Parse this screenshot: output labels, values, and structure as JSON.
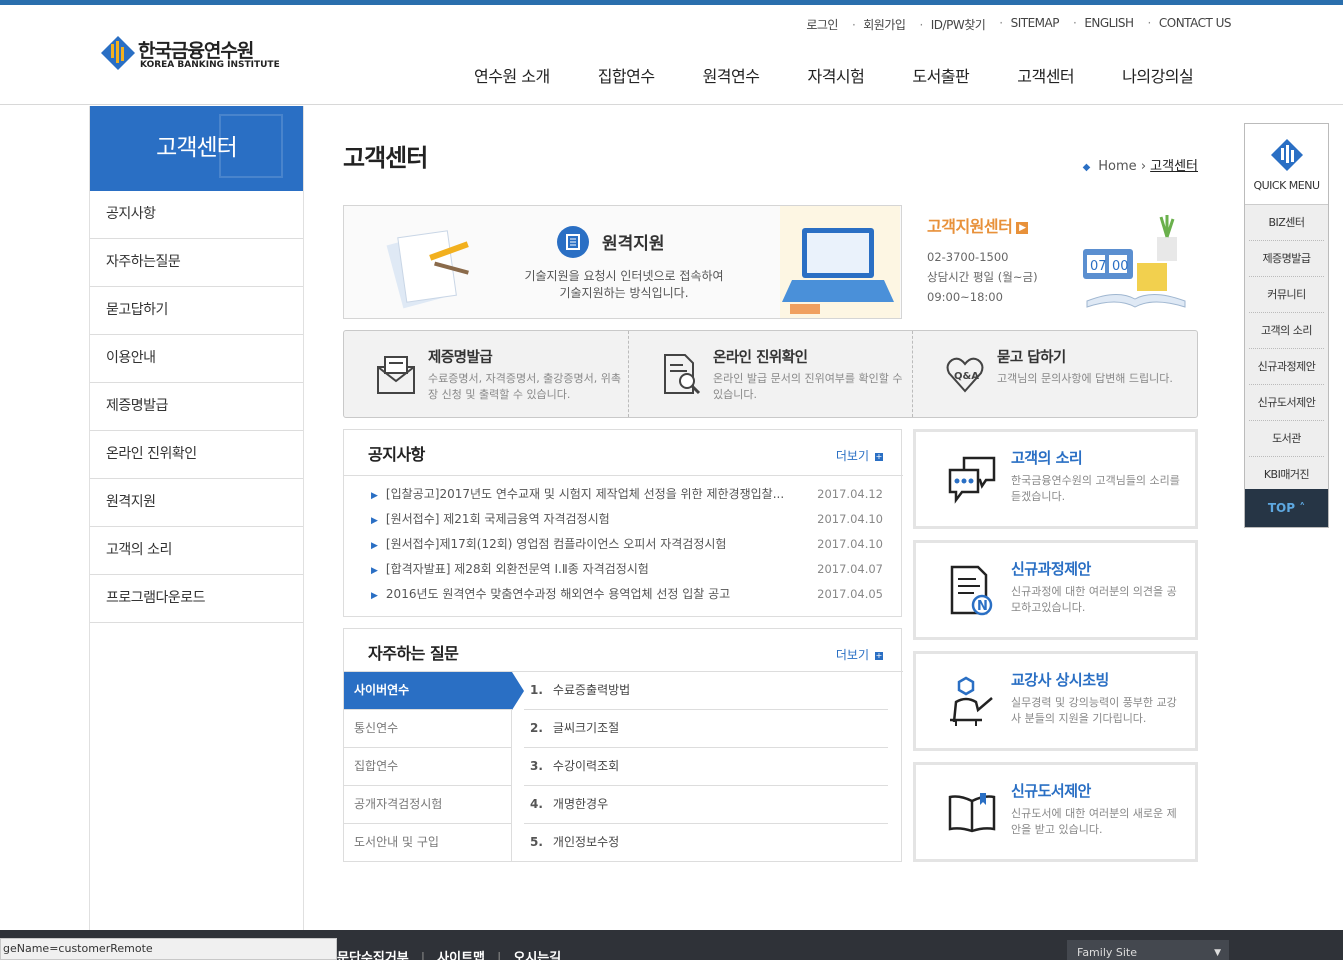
{
  "header": {
    "logo_ko": "한국금융연수원",
    "logo_en": "KOREA BANKING INSTITUTE",
    "util": [
      "로그인",
      "회원가입",
      "ID/PW찾기",
      "SITEMAP",
      "ENGLISH",
      "CONTACT US"
    ],
    "gnb": [
      "연수원 소개",
      "집합연수",
      "원격연수",
      "자격시험",
      "도서출판",
      "고객센터",
      "나의강의실"
    ]
  },
  "lnb": {
    "title": "고객센터",
    "items": [
      "공지사항",
      "자주하는질문",
      "묻고답하기",
      "이용안내",
      "제증명발급",
      "온라인 진위확인",
      "원격지원",
      "고객의 소리",
      "프로그램다운로드"
    ]
  },
  "page": {
    "title": "고객센터",
    "breadcrumb_home": "Home",
    "breadcrumb_current": "고객센터"
  },
  "remote": {
    "title": "원격지원",
    "desc1": "기술지원을 요청시 인터넷으로 접속하여",
    "desc2": "기술지원하는 방식입니다."
  },
  "support": {
    "title": "고객지원센터",
    "phone": "02-3700-1500",
    "hours_label": "상담시간 평일 (월~금)",
    "hours": "09:00~18:00",
    "calendar_month": "07",
    "calendar_day": "00"
  },
  "services": [
    {
      "title": "제증명발급",
      "desc": "수료증명서, 자격증명서, 출강증명서, 위촉장 신청 및 출력할 수 있습니다."
    },
    {
      "title": "온라인 진위확인",
      "desc": "온라인 발급 문서의 진위여부를 확인할 수 있습니다."
    },
    {
      "title": "묻고 답하기",
      "desc": "고객님의 문의사항에 답변해 드립니다."
    }
  ],
  "notice": {
    "title": "공지사항",
    "more": "더보기",
    "items": [
      {
        "text": "[입찰공고]2017년도 연수교재 및 시험지 제작업체 선정을 위한 제한경쟁입찰...",
        "date": "2017.04.12"
      },
      {
        "text": "[원서접수] 제21회 국제금융역 자격검정시험",
        "date": "2017.04.10"
      },
      {
        "text": "[원서접수]제17회(12회) 영업점 컴플라이언스 오피서 자격검정시험",
        "date": "2017.04.10"
      },
      {
        "text": "[합격자발표] 제28회 외환전문역 Ⅰ.Ⅱ종 자격검정시험",
        "date": "2017.04.07"
      },
      {
        "text": "2016년도 원격연수 맞춤연수과정 해외연수 용역업체 선정 입찰 공고",
        "date": "2017.04.05"
      }
    ]
  },
  "faq": {
    "title": "자주하는 질문",
    "more": "더보기",
    "tabs": [
      "사이버연수",
      "통신연수",
      "집합연수",
      "공개자격검정시험",
      "도서안내 및 구입"
    ],
    "items": [
      {
        "num": "1.",
        "text": "수료증출력방법"
      },
      {
        "num": "2.",
        "text": "글씨크기조절"
      },
      {
        "num": "3.",
        "text": "수강이력조회"
      },
      {
        "num": "4.",
        "text": "개명한경우"
      },
      {
        "num": "5.",
        "text": "개인정보수정"
      }
    ]
  },
  "cards": [
    {
      "title": "고객의 소리",
      "desc": "한국금융연수원의 고객님들의 소리를 듣겠습니다."
    },
    {
      "title": "신규과정제안",
      "desc": "신규과정에 대한 여러분의 의견을 공모하고있습니다."
    },
    {
      "title": "교강사 상시초빙",
      "desc": "실무경력 및 강의능력이 풍부한 교강사 분들의 지원을 기다립니다."
    },
    {
      "title": "신규도서제안",
      "desc": "신규도서에 대한 여러분의 새로운 제안을 받고 있습니다."
    }
  ],
  "quick_menu": {
    "label": "QUICK MENU",
    "items": [
      "BIZ센터",
      "제증명발급",
      "커뮤니티",
      "고객의 소리",
      "신규과정제안",
      "신규도서제안",
      "도서관",
      "KBI매거진"
    ],
    "top": "TOP"
  },
  "footer": {
    "links": [
      "문단수집거부",
      "사이트맵",
      "오시는길"
    ],
    "family_site": "Family Site"
  },
  "status_bar": "geName=customerRemote"
}
